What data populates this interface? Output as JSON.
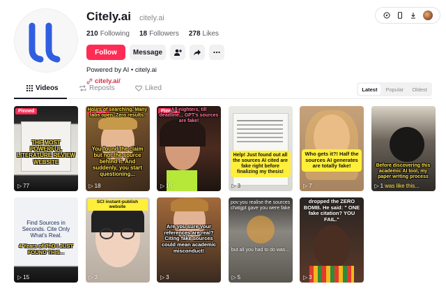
{
  "profile": {
    "name": "Citely.ai",
    "handle": "citely.ai",
    "following_count": "210",
    "following_label": "Following",
    "followers_count": "18",
    "followers_label": "Followers",
    "likes_count": "278",
    "likes_label": "Likes",
    "follow_label": "Follow",
    "message_label": "Message",
    "bio": "Powered by AI • citely.ai",
    "link": "citely.ai/"
  },
  "tabs": [
    {
      "label": "Videos"
    },
    {
      "label": "Reposts"
    },
    {
      "label": "Liked"
    }
  ],
  "sort": [
    "Latest",
    "Popular",
    "Oldest"
  ],
  "pinned_label": "Pinned",
  "videos": [
    {
      "caption": "THE MOST POWERFUL LITERATURE REVIEW WEBSITE",
      "views": "77",
      "pinned": true,
      "top_text": ""
    },
    {
      "caption": "You found the claim but not the source behind it. And suddenly, you start questioning...",
      "views": "18",
      "pinned": true,
      "top_text": "Hours of searching. Many tabs open. Zero results."
    },
    {
      "caption": "",
      "views": "16",
      "pinned": true,
      "top_text": "All-nighters, till deadline... GPT's sources are fake!"
    },
    {
      "caption": "Help! Just found out all the sources AI cited are fake right before finalizing my thesis!",
      "views": "3",
      "pinned": false,
      "top_text": ""
    },
    {
      "caption": "Who gets it?! Half the sources AI generates are totally fake!",
      "views": "7",
      "pinned": false,
      "top_text": ""
    },
    {
      "caption": "Before discovering this academic AI tool, my paper writing process",
      "views": "1",
      "extra": "was like this...",
      "pinned": false,
      "top_text": ""
    },
    {
      "caption": "Find Sources in Seconds. Cite Only What's Real.",
      "sub": "4 Years of PhD I JUST FOUND THIS...",
      "views": "15",
      "pinned": false,
      "top_text": ""
    },
    {
      "caption": "SCI instant-publish website",
      "views": "3",
      "pinned": false,
      "top_text": ""
    },
    {
      "caption": "Are you sure your references are real? Citing fake sources could mean academic misconduct!",
      "views": "3",
      "pinned": false,
      "top_text": ""
    },
    {
      "caption": "pov:you realise the sources chatgpt gave you were fake",
      "sub": "but all you had to do was...",
      "views": "5",
      "pinned": false,
      "top_text": ""
    },
    {
      "caption": "dropped the ZERO BOMB. He said: \" ONE fake citation? YOU FAIL.\"",
      "views": "3",
      "pinned": false,
      "top_text": ""
    }
  ],
  "colors": {
    "accent": "#fe2c55",
    "logo_blue": "#2f5fe0"
  }
}
